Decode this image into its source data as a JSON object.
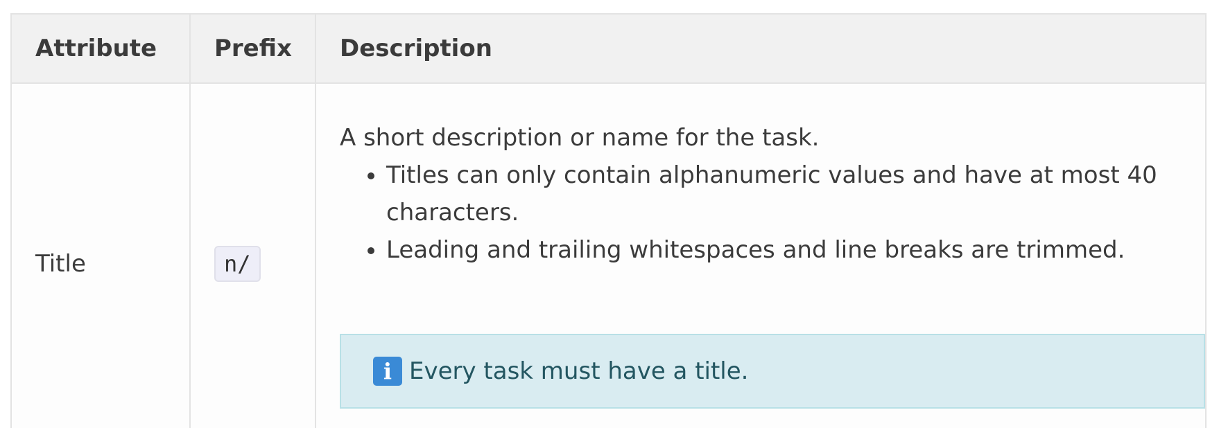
{
  "table": {
    "headers": [
      "Attribute",
      "Prefix",
      "Description"
    ],
    "rows": [
      {
        "attribute": "Title",
        "prefix": "n/",
        "description": {
          "intro": "A short description or name for the task.",
          "bullets": [
            "Titles can only contain alphanumeric values and have at most 40 characters.",
            "Leading and trailing whitespaces and line breaks are trimmed."
          ],
          "info_box": {
            "icon": "info-icon",
            "text": "Every task must have a title."
          }
        }
      }
    ]
  },
  "colors": {
    "header_bg": "#f1f1f1",
    "info_box_bg": "#d9ecf1",
    "info_box_text": "#235661",
    "info_icon_bg": "#3a8ad6"
  }
}
